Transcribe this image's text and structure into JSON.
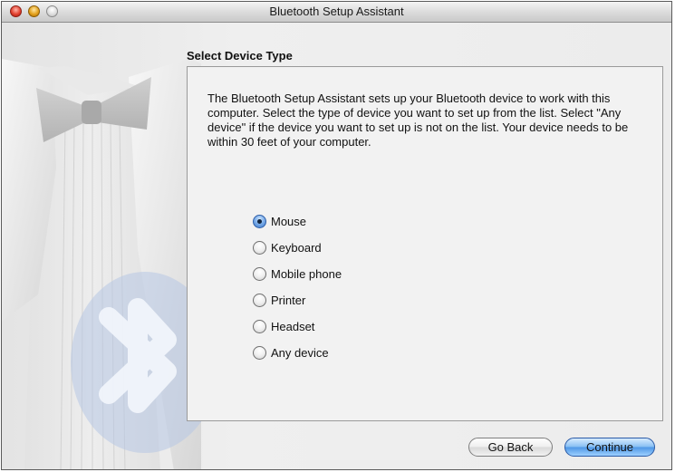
{
  "window": {
    "title": "Bluetooth Setup Assistant"
  },
  "main": {
    "section_title": "Select Device Type",
    "description": "The Bluetooth Setup Assistant sets up your Bluetooth device to work with this computer. Select the type of device you want to set up from the list. Select \"Any device\" if the device you want to set up is not on the list. Your device needs to be within 30 feet of your computer.",
    "device_options": [
      {
        "label": "Mouse",
        "selected": true
      },
      {
        "label": "Keyboard",
        "selected": false
      },
      {
        "label": "Mobile phone",
        "selected": false
      },
      {
        "label": "Printer",
        "selected": false
      },
      {
        "label": "Headset",
        "selected": false
      },
      {
        "label": "Any device",
        "selected": false
      }
    ]
  },
  "buttons": {
    "back_label": "Go Back",
    "continue_label": "Continue"
  },
  "icons": {
    "close": "close-icon",
    "minimize": "minimize-icon",
    "zoom": "zoom-icon",
    "bluetooth": "bluetooth-icon"
  },
  "colors": {
    "default_button": "#4f97e6",
    "selected_radio": "#3c79cc"
  }
}
